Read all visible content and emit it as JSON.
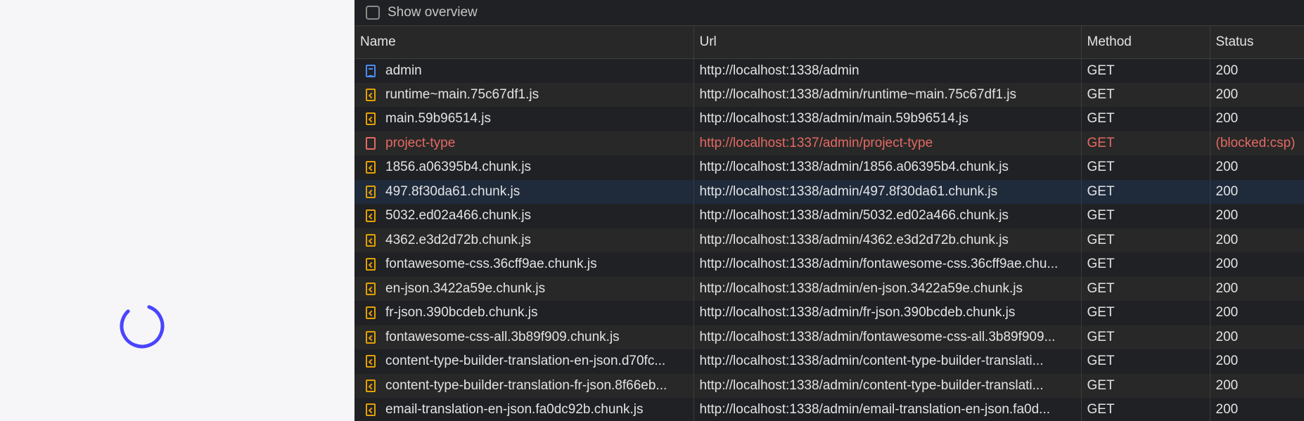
{
  "devtools": {
    "show_overview_label": "Show overview",
    "columns": [
      "Name",
      "Url",
      "Method",
      "Status"
    ],
    "rows": [
      {
        "name": "admin",
        "url": "http://localhost:1338/admin",
        "method": "GET",
        "status": "200",
        "icon": "document-icon",
        "state": "normal"
      },
      {
        "name": "runtime~main.75c67df1.js",
        "url": "http://localhost:1338/admin/runtime~main.75c67df1.js",
        "method": "GET",
        "status": "200",
        "icon": "script-icon",
        "state": "normal"
      },
      {
        "name": "main.59b96514.js",
        "url": "http://localhost:1338/admin/main.59b96514.js",
        "method": "GET",
        "status": "200",
        "icon": "script-icon",
        "state": "normal"
      },
      {
        "name": "project-type",
        "url": "http://localhost:1337/admin/project-type",
        "method": "GET",
        "status": "(blocked:csp)",
        "icon": "blocked-icon",
        "state": "error"
      },
      {
        "name": "1856.a06395b4.chunk.js",
        "url": "http://localhost:1338/admin/1856.a06395b4.chunk.js",
        "method": "GET",
        "status": "200",
        "icon": "script-icon",
        "state": "normal"
      },
      {
        "name": "497.8f30da61.chunk.js",
        "url": "http://localhost:1338/admin/497.8f30da61.chunk.js",
        "method": "GET",
        "status": "200",
        "icon": "script-icon",
        "state": "selected"
      },
      {
        "name": "5032.ed02a466.chunk.js",
        "url": "http://localhost:1338/admin/5032.ed02a466.chunk.js",
        "method": "GET",
        "status": "200",
        "icon": "script-icon",
        "state": "normal"
      },
      {
        "name": "4362.e3d2d72b.chunk.js",
        "url": "http://localhost:1338/admin/4362.e3d2d72b.chunk.js",
        "method": "GET",
        "status": "200",
        "icon": "script-icon",
        "state": "normal"
      },
      {
        "name": "fontawesome-css.36cff9ae.chunk.js",
        "url": "http://localhost:1338/admin/fontawesome-css.36cff9ae.chu...",
        "method": "GET",
        "status": "200",
        "icon": "script-icon",
        "state": "normal"
      },
      {
        "name": "en-json.3422a59e.chunk.js",
        "url": "http://localhost:1338/admin/en-json.3422a59e.chunk.js",
        "method": "GET",
        "status": "200",
        "icon": "script-icon",
        "state": "normal"
      },
      {
        "name": "fr-json.390bcdeb.chunk.js",
        "url": "http://localhost:1338/admin/fr-json.390bcdeb.chunk.js",
        "method": "GET",
        "status": "200",
        "icon": "script-icon",
        "state": "normal"
      },
      {
        "name": "fontawesome-css-all.3b89f909.chunk.js",
        "url": "http://localhost:1338/admin/fontawesome-css-all.3b89f909...",
        "method": "GET",
        "status": "200",
        "icon": "script-icon",
        "state": "normal"
      },
      {
        "name": "content-type-builder-translation-en-json.d70fc...",
        "url": "http://localhost:1338/admin/content-type-builder-translati...",
        "method": "GET",
        "status": "200",
        "icon": "script-icon",
        "state": "normal"
      },
      {
        "name": "content-type-builder-translation-fr-json.8f66eb...",
        "url": "http://localhost:1338/admin/content-type-builder-translati...",
        "method": "GET",
        "status": "200",
        "icon": "script-icon",
        "state": "normal"
      },
      {
        "name": "email-translation-en-json.fa0dc92b.chunk.js",
        "url": "http://localhost:1338/admin/email-translation-en-json.fa0d...",
        "method": "GET",
        "status": "200",
        "icon": "script-icon",
        "state": "normal"
      }
    ]
  },
  "colors": {
    "spinner": "#4945ff",
    "error_text": "#e46962",
    "selected_row": "#1f2a3b"
  }
}
